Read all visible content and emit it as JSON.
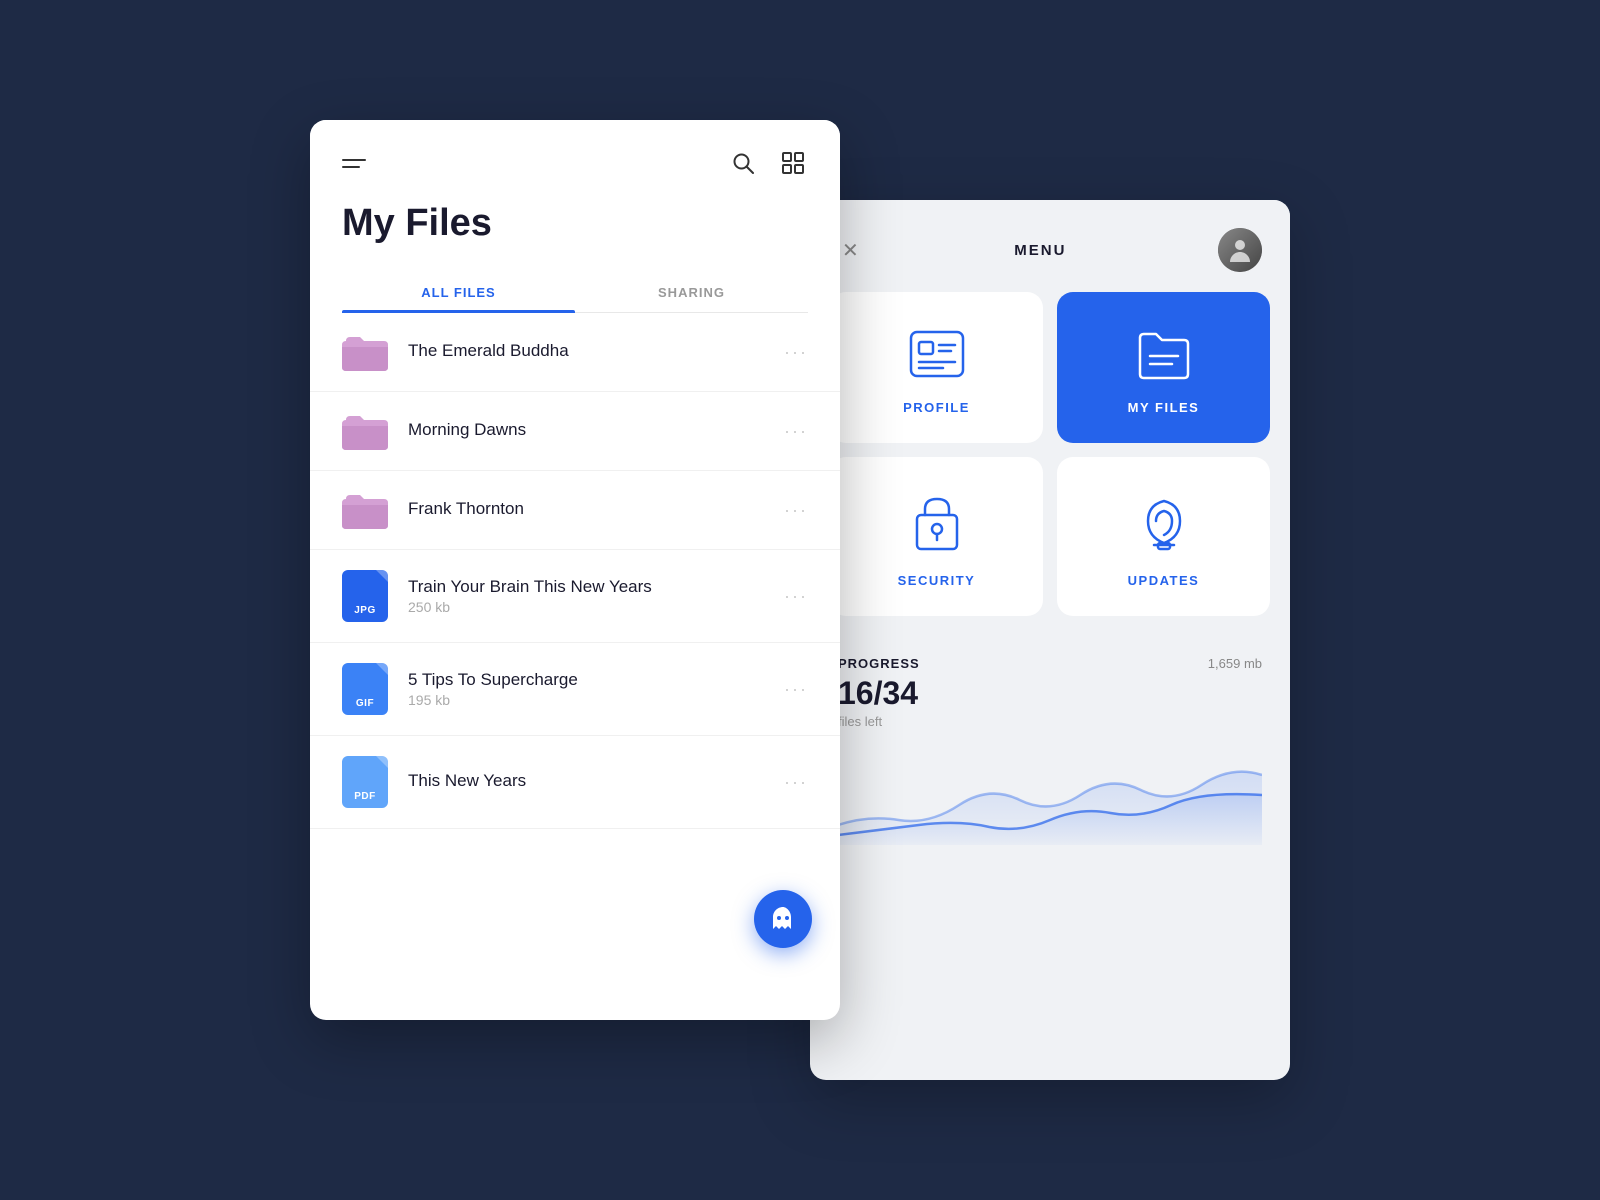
{
  "background_color": "#1e2a45",
  "files_panel": {
    "title": "My Files",
    "tabs": [
      {
        "id": "all-files",
        "label": "ALL FILES",
        "active": true
      },
      {
        "id": "sharing",
        "label": "SHARING",
        "active": false
      }
    ],
    "items": [
      {
        "id": "folder-1",
        "type": "folder",
        "name": "The Emerald Buddha",
        "size": null
      },
      {
        "id": "folder-2",
        "type": "folder",
        "name": "Morning Dawns",
        "size": null
      },
      {
        "id": "folder-3",
        "type": "folder",
        "name": "Frank Thornton",
        "size": null
      },
      {
        "id": "file-1",
        "type": "file",
        "badge": "JPG",
        "name": "Train Your Brain This New Years",
        "size": "250 kb"
      },
      {
        "id": "file-2",
        "type": "file",
        "badge": "GIF",
        "name": "5 Tips To Supercharge",
        "size": "195 kb"
      },
      {
        "id": "file-3",
        "type": "file",
        "badge": "PDF",
        "name": "This New Years",
        "size": null
      }
    ],
    "more_label": "···"
  },
  "menu_panel": {
    "title": "MENU",
    "close_label": "✕",
    "items": [
      {
        "id": "profile",
        "label": "PROFILE",
        "active": false
      },
      {
        "id": "my-files",
        "label": "MY FILES",
        "active": true
      },
      {
        "id": "security",
        "label": "SECURITY",
        "active": false
      },
      {
        "id": "updates",
        "label": "UPDATES",
        "active": false
      }
    ],
    "progress": {
      "label": "PROGRESS",
      "size": "1,659 mb",
      "count": "16/34",
      "sub": "files left"
    }
  }
}
